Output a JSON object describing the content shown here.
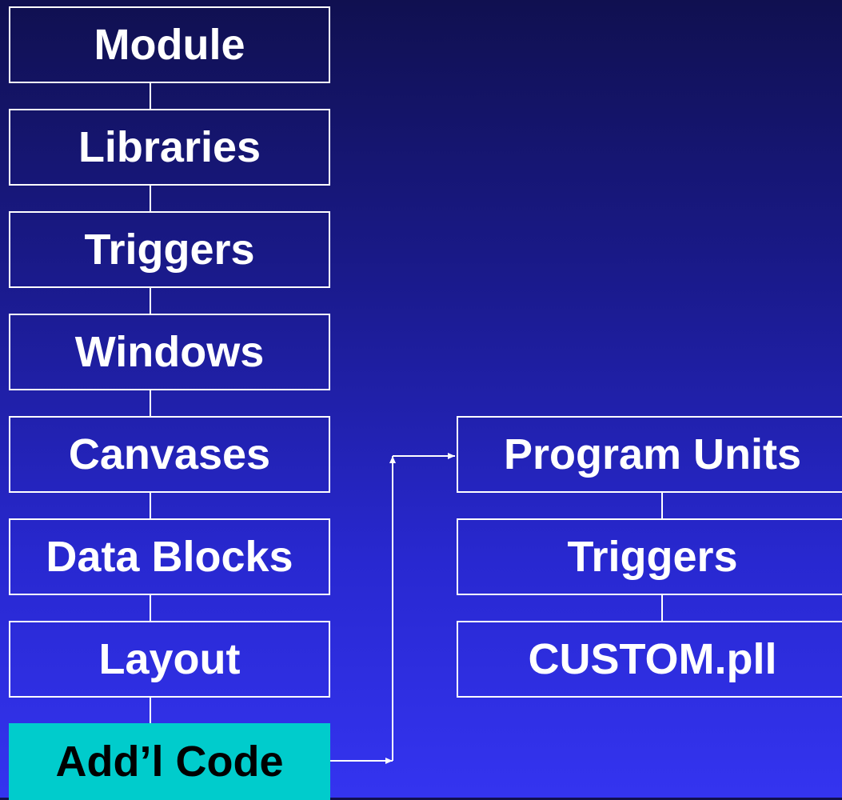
{
  "left_column": [
    {
      "label": "Module"
    },
    {
      "label": "Libraries"
    },
    {
      "label": "Triggers"
    },
    {
      "label": "Windows"
    },
    {
      "label": "Canvases"
    },
    {
      "label": "Data Blocks"
    },
    {
      "label": "Layout"
    },
    {
      "label": "Add’l Code",
      "highlighted": true
    }
  ],
  "right_column": [
    {
      "label": "Program Units"
    },
    {
      "label": "Triggers"
    },
    {
      "label": "CUSTOM.pll"
    }
  ],
  "colors": {
    "highlight": "#00cccc",
    "line": "#ffffff",
    "text": "#ffffff"
  }
}
